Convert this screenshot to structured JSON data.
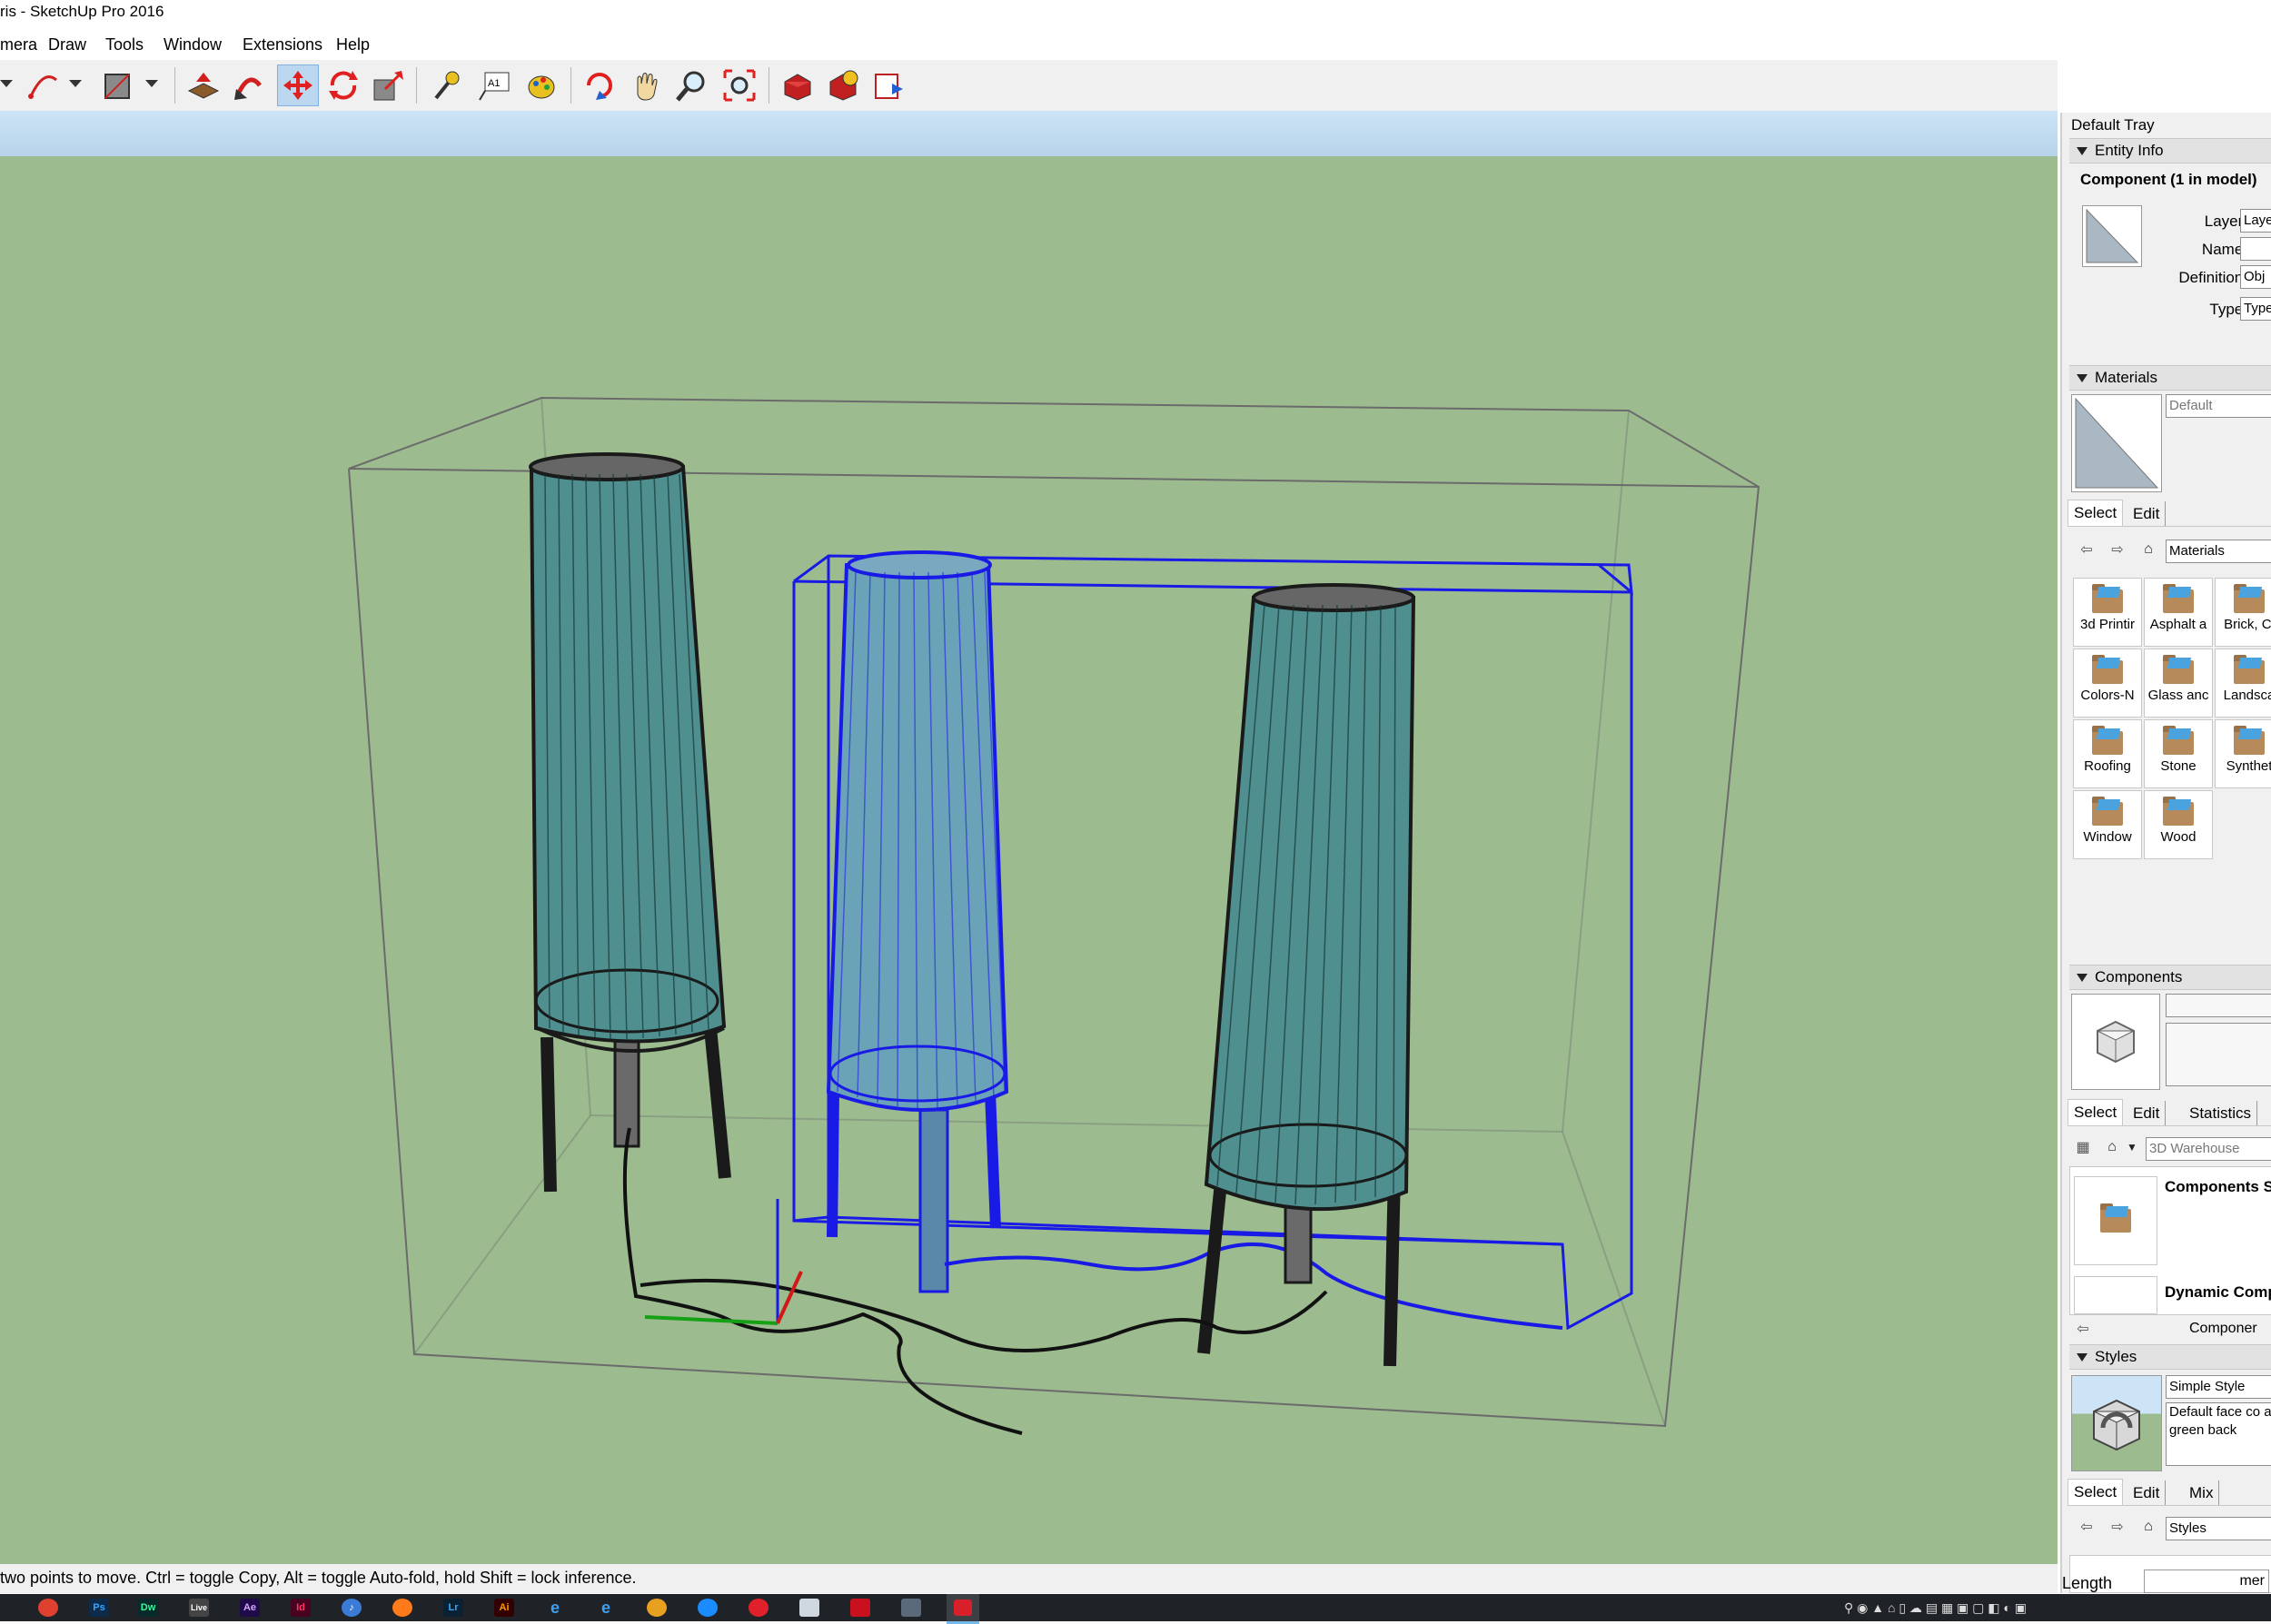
{
  "window": {
    "title": "ris - SketchUp Pro 2016"
  },
  "menu": [
    "mera",
    "Draw",
    "Tools",
    "Window",
    "Extensions",
    "Help"
  ],
  "toolbar": {
    "tools": [
      "arc-tool",
      "shape-tool",
      "push-pull-tool",
      "follow-me-tool",
      "move-tool",
      "rotate-tool",
      "scale-tool",
      "tape-measure-tool",
      "text-tool",
      "paint-bucket-tool",
      "orbit-tool",
      "pan-tool",
      "zoom-tool",
      "zoom-extents-tool",
      "3d-warehouse-tool",
      "extension-warehouse-tool",
      "send-to-layout-tool"
    ],
    "active_tool": "move-tool"
  },
  "status_bar": {
    "text": "two points to move.  Ctrl = toggle Copy, Alt = toggle Auto-fold, hold Shift = lock inference."
  },
  "viewport": {
    "background_color": "#9cbc8f",
    "selection_color": "#1a1ae6"
  },
  "tray": {
    "title": "Default Tray",
    "entity_info": {
      "header": "Entity Info",
      "heading": "Component (1 in model)",
      "fields": [
        {
          "label": "Layer:",
          "value": "Laye"
        },
        {
          "label": "Name:",
          "value": ""
        },
        {
          "label": "Definition:",
          "value": "Obj"
        },
        {
          "label": "Type:",
          "value": "Type"
        }
      ]
    },
    "materials": {
      "header": "Materials",
      "current": "Default",
      "tabs": [
        "Select",
        "Edit"
      ],
      "library": "Materials",
      "folders": [
        "3d Printir",
        "Asphalt a",
        "Brick, Cl",
        "Colors-N",
        "Glass anc",
        "Landsca",
        "Roofing",
        "Stone",
        "Synthet",
        "Window",
        "Wood"
      ]
    },
    "components": {
      "header": "Components",
      "tabs": [
        "Select",
        "Edit",
        "Statistics"
      ],
      "search_placeholder": "3D Warehouse",
      "items": [
        "Components S",
        "Dynamic Comp"
      ],
      "nav_label": "Componer"
    },
    "styles": {
      "header": "Styles",
      "name": "Simple Style",
      "description": "Default face co and green back",
      "tabs": [
        "Select",
        "Edit",
        "Mix"
      ],
      "library": "Styles"
    },
    "measurements": {
      "label": "Length",
      "value": "mer"
    }
  },
  "taskbar": {
    "apps": [
      "Chrome",
      "Ps",
      "Dw",
      "Live",
      "Ae",
      "Id",
      "iTunes",
      "Firefox",
      "Lr",
      "Ai",
      "IE",
      "Edge",
      "Br",
      "Sp",
      "Opera",
      "Mail",
      "Acrobat",
      "Photos",
      "SketchUp"
    ]
  }
}
